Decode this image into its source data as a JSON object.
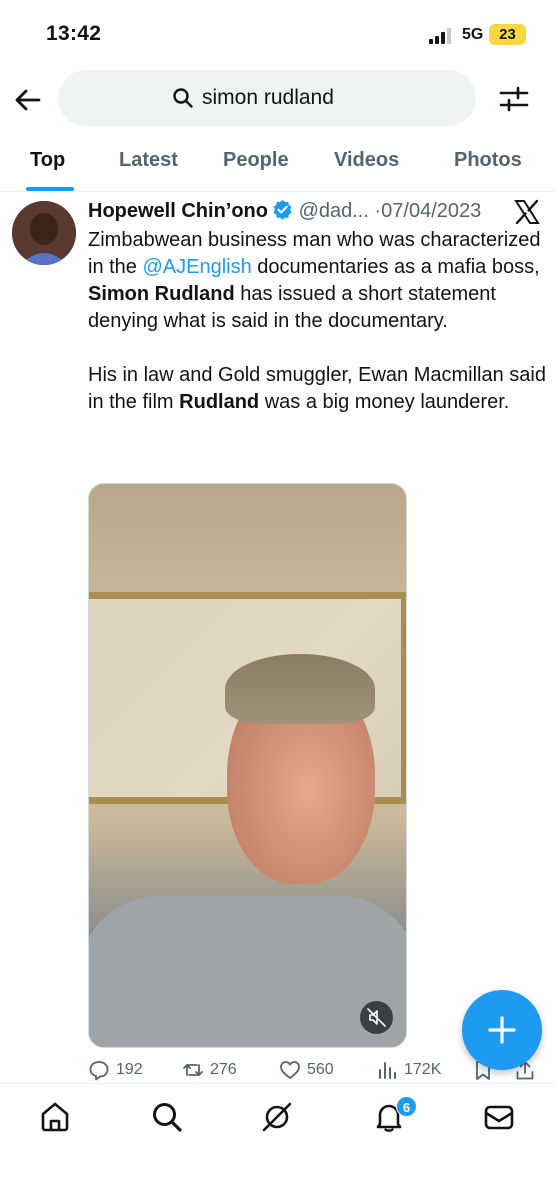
{
  "status_bar": {
    "time": "13:42",
    "network": "5G",
    "battery": "23"
  },
  "search": {
    "value": "simon rudland",
    "placeholder": "Search"
  },
  "tabs": [
    {
      "label": "Top",
      "active": true
    },
    {
      "label": "Latest"
    },
    {
      "label": "People"
    },
    {
      "label": "Videos"
    },
    {
      "label": "Photos"
    }
  ],
  "tweet": {
    "author": "Hopewell Chin’ono",
    "handle": "@dad...",
    "separator": "·",
    "date": "07/04/2023",
    "text": {
      "p1_a": "Zimbabwean business man who was characterized in the ",
      "p1_mention": "@AJEnglish",
      "p1_b": " documentaries as a mafia boss, ",
      "p1_bold": "Simon Rudland",
      "p1_c": " has issued a short statement denying what is said in the documentary.",
      "p2_a": "His in law and Gold smuggler, Ewan Macmillan said in the film ",
      "p2_bold": "Rudland",
      "p2_b": " was a big money launderer."
    },
    "stats": {
      "replies": "192",
      "retweets": "276",
      "likes": "560",
      "views": "172K"
    }
  },
  "bottom_nav": {
    "notification_count": "6"
  },
  "colors": {
    "accent": "#1d9bf0",
    "text": "#0f1419",
    "secondary": "#536471",
    "search_bg": "#eff3f4",
    "battery": "#f7d83e"
  },
  "icons": [
    "back-arrow-icon",
    "search-icon",
    "filter-sliders-icon",
    "verified-badge-icon",
    "x-logo-icon",
    "mute-icon",
    "reply-icon",
    "retweet-icon",
    "like-icon",
    "views-icon",
    "bookmark-icon",
    "share-icon",
    "plus-icon",
    "home-icon",
    "explore-icon",
    "grok-icon",
    "bell-icon",
    "mail-icon"
  ]
}
